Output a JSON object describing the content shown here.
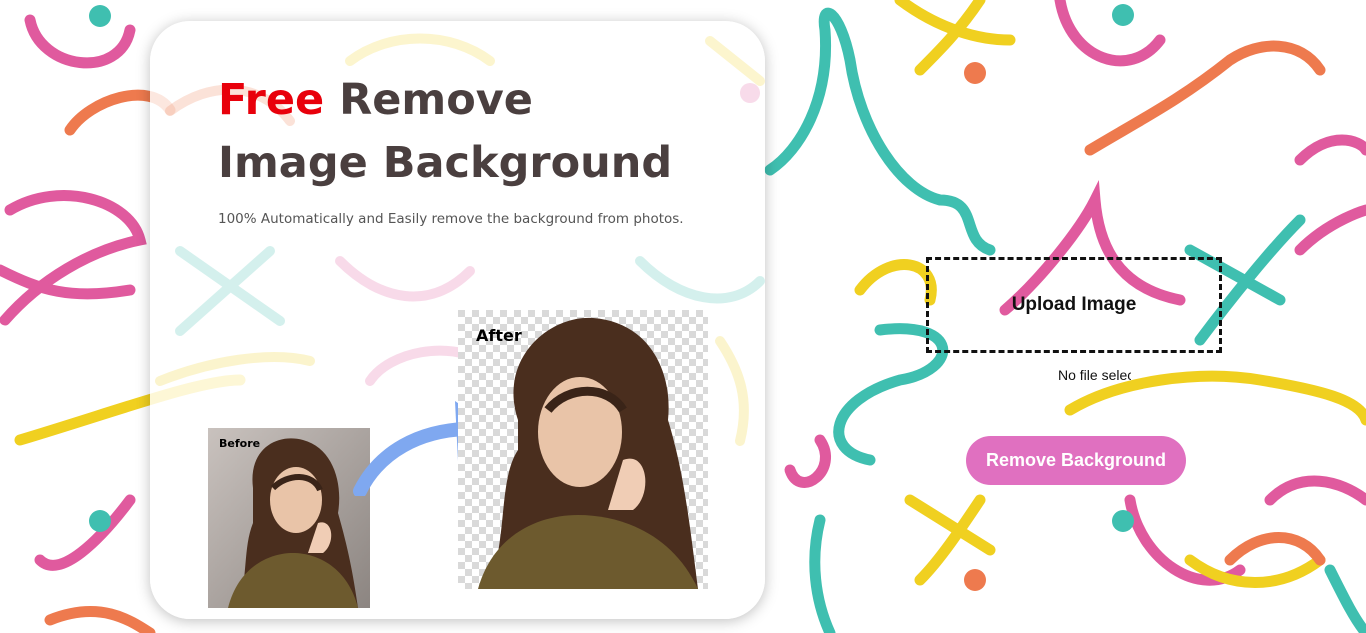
{
  "hero": {
    "title_accent": "Free",
    "title_rest_line1": " Remove",
    "title_line2": "Image Background",
    "subtitle": "100% Automatically and Easily remove the background from photos."
  },
  "demo": {
    "before_label": "Before",
    "after_label": "After"
  },
  "upload": {
    "label": "Upload Image",
    "file_status": "No file selected."
  },
  "action": {
    "remove_label": "Remove Background"
  },
  "colors": {
    "accent_red": "#e8000b",
    "button_pink": "#e070c0",
    "squiggle_pink": "#e05a9e",
    "squiggle_teal": "#3fbfb0",
    "squiggle_yellow": "#f0d020",
    "squiggle_orange": "#ee7a4e"
  }
}
